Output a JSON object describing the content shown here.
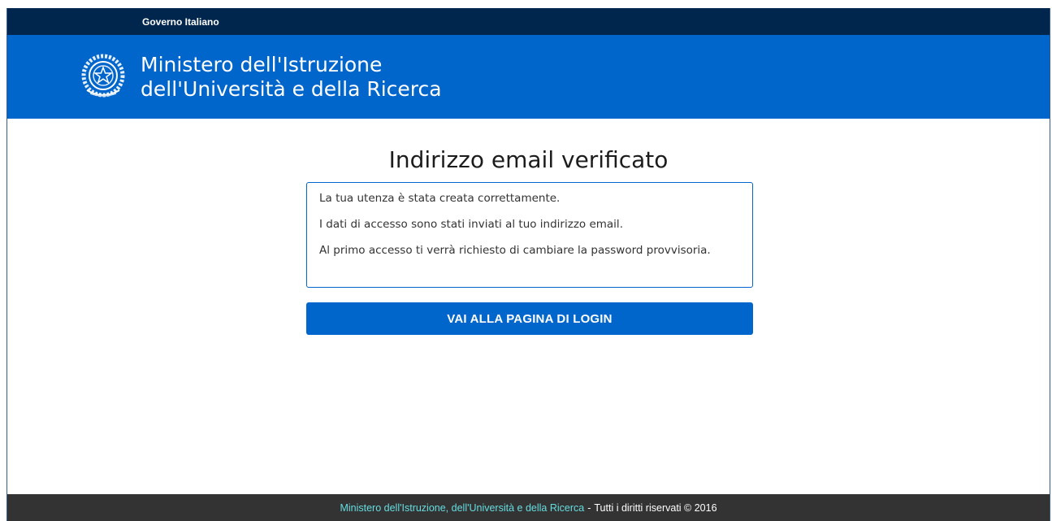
{
  "gov_bar": {
    "label": "Governo Italiano"
  },
  "header": {
    "emblem_icon": "repubblica-italiana-emblem",
    "ministry_line1": "Ministero dell'Istruzione",
    "ministry_line2": "dell'Università e della Ricerca"
  },
  "main": {
    "title": "Indirizzo email verificato",
    "messages": [
      "La tua utenza è stata creata correttamente.",
      "I dati di accesso sono stati inviati al tuo indirizzo email.",
      "Al primo accesso ti verrà richiesto di cambiare la password provvisoria."
    ],
    "login_button": "VAI ALLA PAGINA DI LOGIN"
  },
  "footer": {
    "link": "Ministero dell'Istruzione, dell'Università e della Ricerca",
    "separator": "-",
    "rights": "Tutti i diritti riservati © 2016"
  },
  "colors": {
    "gov_bar": "#00264d",
    "header": "#0066cc",
    "button": "#0066cc",
    "footer": "#333333",
    "footer_link": "#65dde0"
  }
}
